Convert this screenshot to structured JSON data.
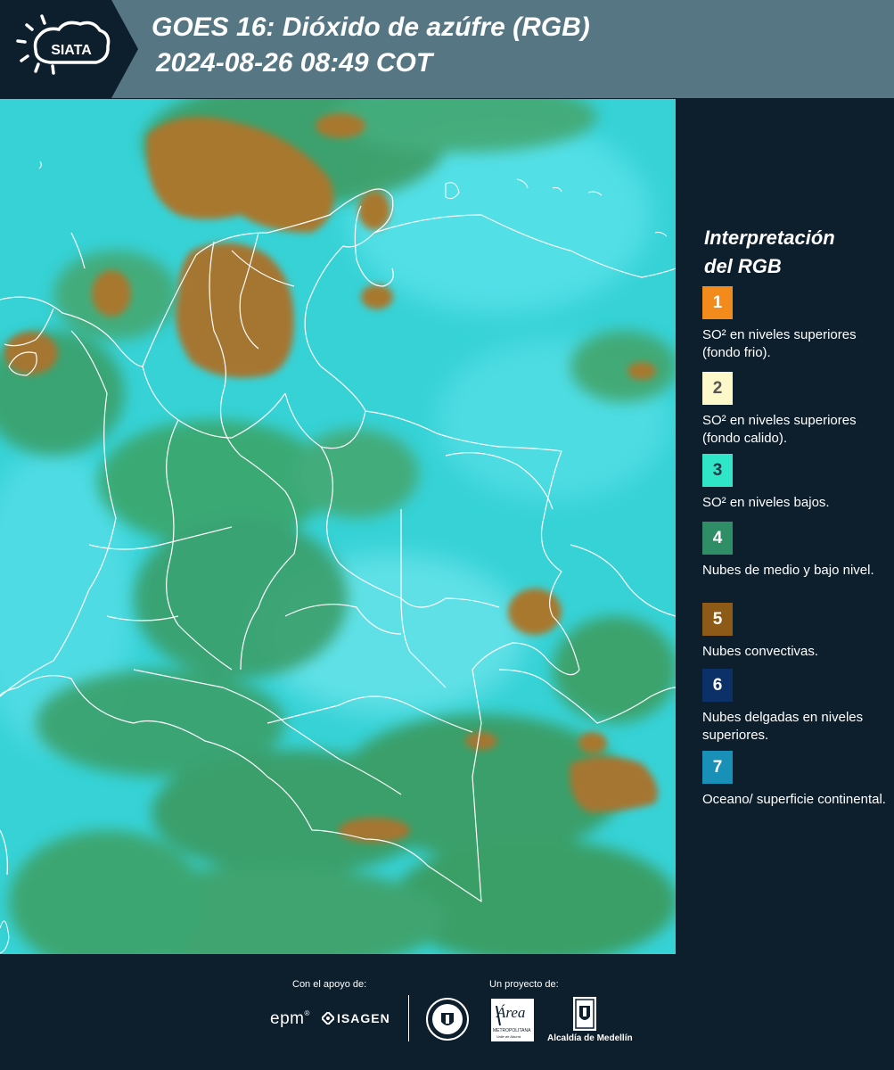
{
  "header": {
    "logo_text": "SIATA",
    "title": "GOES 16: Dióxido de azúfre (RGB)",
    "timestamp": "2024-08-26 08:49 COT"
  },
  "legend": {
    "title_line1": "Interpretación",
    "title_line2": "del RGB",
    "items": [
      {
        "number": "1",
        "label": "SO² en niveles superiores (fondo frio).",
        "color": "#f28a1c",
        "number_color": "#ffffff"
      },
      {
        "number": "2",
        "label": "SO² en niveles superiores (fondo calido).",
        "color": "#fdf8c9",
        "number_color": "#555555"
      },
      {
        "number": "3",
        "label": "SO² en niveles bajos.",
        "color": "#2fe7c7",
        "number_color": "#1b3a48"
      },
      {
        "number": "4",
        "label": "Nubes de medio y bajo nivel.",
        "color": "#2f8e66",
        "number_color": "#ffffff"
      },
      {
        "number": "5",
        "label": "Nubes convectivas.",
        "color": "#8d5a17",
        "number_color": "#ffffff"
      },
      {
        "number": "6",
        "label": "Nubes delgadas en niveles superiores.",
        "color": "#0b3168",
        "number_color": "#ffffff"
      },
      {
        "number": "7",
        "label": "Oceano/ superficie continental.",
        "color": "#1890b8",
        "number_color": "#ffffff"
      }
    ]
  },
  "footer": {
    "support_label": "Con el apoyo de:",
    "project_label": "Un proyecto de:",
    "sponsors": [
      "epm",
      "ISAGEN"
    ],
    "metro_brand": "Área",
    "metro_line1": "METROPOLITANA",
    "metro_line2": "Valle de Aburrá",
    "alcaldia": "Alcaldía de Medellín"
  },
  "colors": {
    "header_bg": "#567683",
    "panel_bg": "#0d1e2c",
    "map_base": "#34d3d8",
    "cloud_green": "#2f8f4e",
    "convective_brown": "#a57a2e"
  }
}
